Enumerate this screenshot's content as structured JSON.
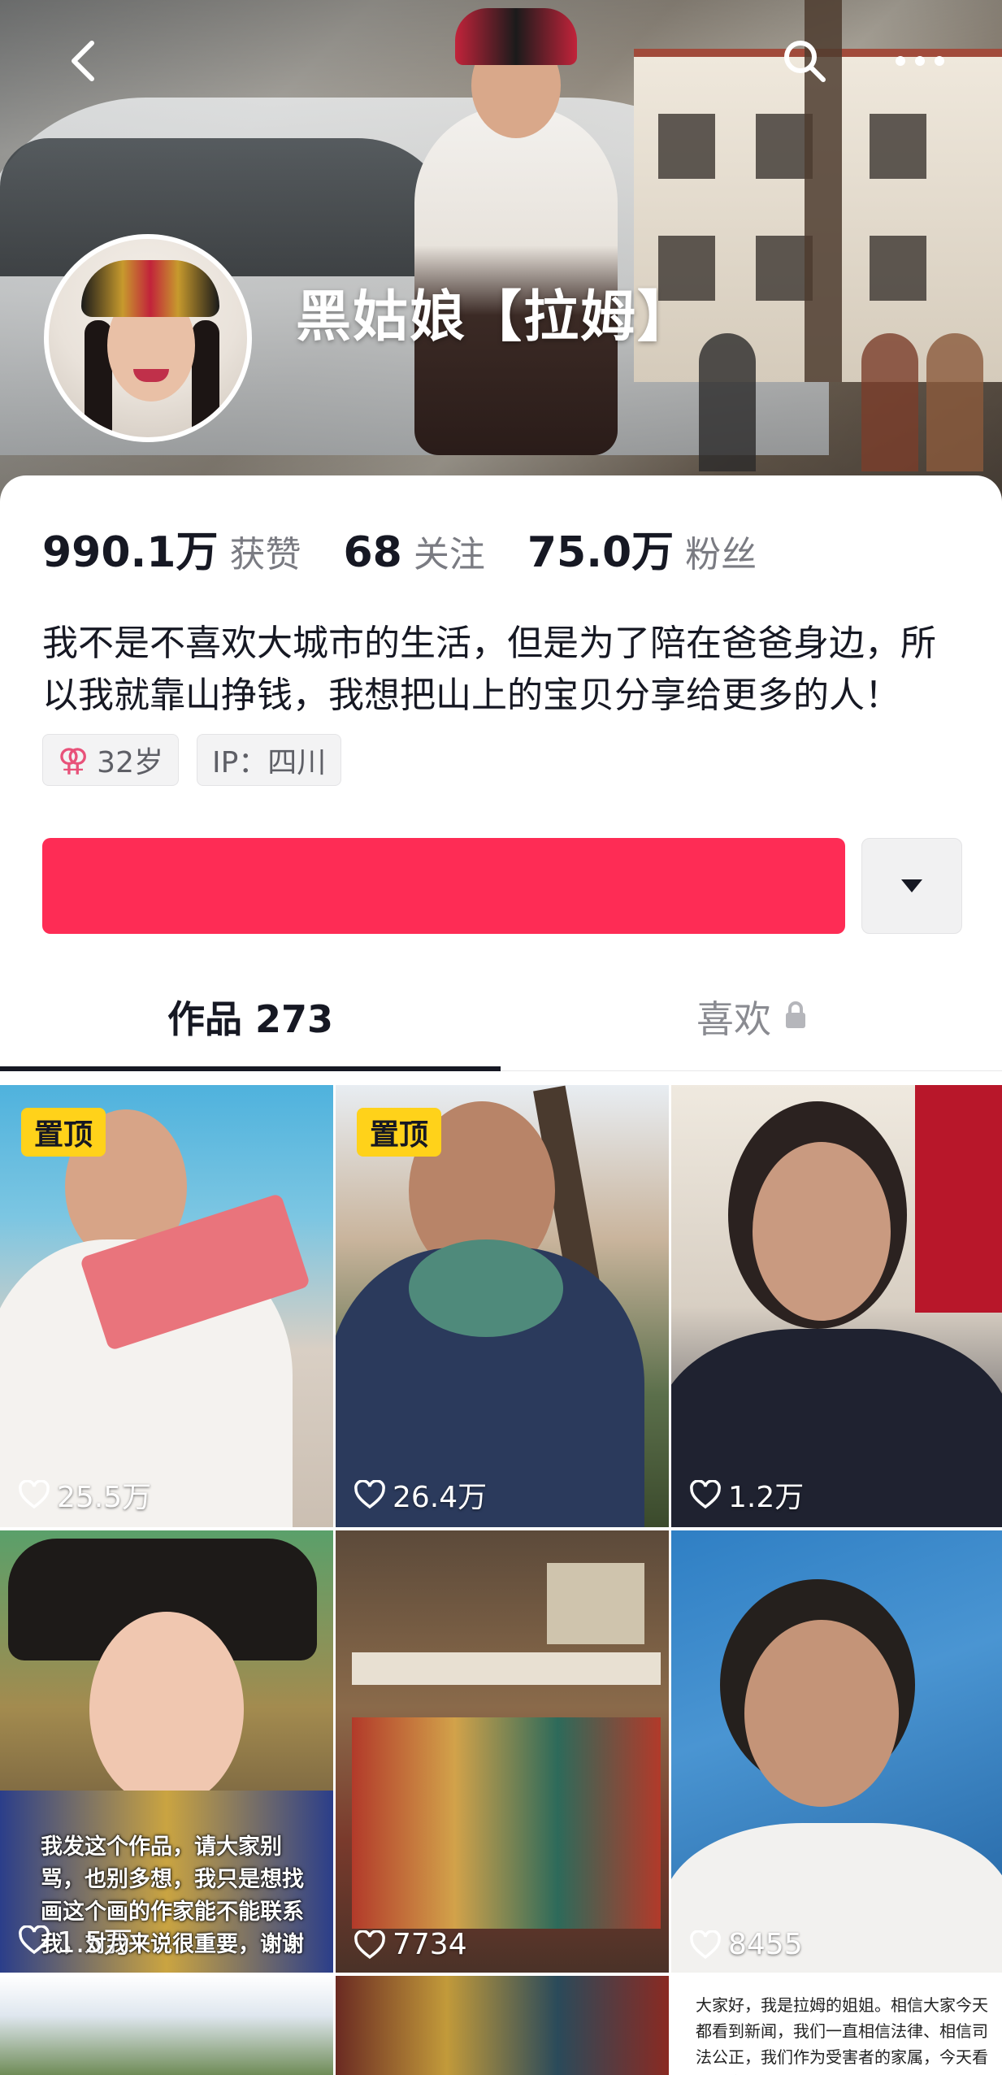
{
  "profile": {
    "name": "黑姑娘【拉姆】",
    "stats": [
      {
        "num": "990.1万",
        "label": "获赞"
      },
      {
        "num": "68",
        "label": "关注"
      },
      {
        "num": "75.0万",
        "label": "粉丝"
      }
    ],
    "bio": "我不是不喜欢大城市的生活，但是为了陪在爸爸身边，所以我就靠山挣钱，我想把山上的宝贝分享给更多的人！",
    "age_tag": "32岁",
    "age_symbol": "⚢",
    "ip_tag": "IP：四川"
  },
  "icons": {
    "back": "back-arrow-icon",
    "search": "search-icon",
    "more": "more-dots-icon",
    "dropdown": "caret-down-icon",
    "lock": "lock-icon",
    "heart": "heart-icon"
  },
  "follow_button": {
    "label": ""
  },
  "tabs": [
    {
      "label": "作品 273",
      "active": true
    },
    {
      "label": "喜欢",
      "active": false
    }
  ],
  "videos": [
    {
      "likes": "25.5万",
      "pinned": true,
      "pin_label": "置顶"
    },
    {
      "likes": "26.4万",
      "pinned": true,
      "pin_label": "置顶"
    },
    {
      "likes": "1.2万",
      "pinned": false
    },
    {
      "likes": "1.5万",
      "pinned": false,
      "caption": "我发这个作品，请大家别骂，也别多想，我只是想找画这个画的作家能不能联系我，对我来说很重要，谢谢"
    },
    {
      "likes": "7734",
      "pinned": false
    },
    {
      "likes": "8455",
      "pinned": false
    },
    {
      "likes": "",
      "pinned": false
    },
    {
      "likes": "",
      "pinned": false
    },
    {
      "likes": "",
      "pinned": false,
      "caption": "大家好，我是拉姆的姐姐。相信大家今天都看到新闻，我们一直相信法律、相信司法公正，我们作为受害者的家属，今天看到消息，情绪很复"
    }
  ],
  "colors": {
    "accent": "#fe2c55",
    "pin_badge": "#ffd21a",
    "text_primary": "#161823",
    "text_secondary": "#7a7b82"
  }
}
